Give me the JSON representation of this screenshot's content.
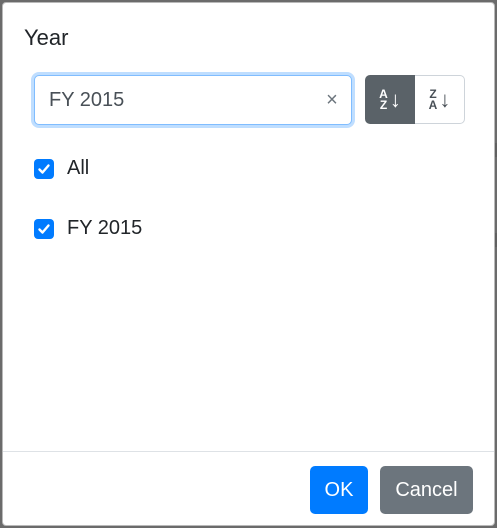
{
  "dialog": {
    "title": "Year",
    "search": {
      "value": "FY 2015",
      "clear_glyph": "×"
    },
    "sort": {
      "ascending": {
        "top": "A",
        "bottom": "Z",
        "arrow": "↓",
        "active": true
      },
      "descending": {
        "top": "Z",
        "bottom": "A",
        "arrow": "↓",
        "active": false
      }
    },
    "options": [
      {
        "label": "All",
        "checked": true
      },
      {
        "label": "FY 2015",
        "checked": true
      }
    ],
    "footer": {
      "ok_label": "OK",
      "cancel_label": "Cancel"
    }
  },
  "colors": {
    "primary": "#007bff",
    "secondary": "#6c757d",
    "sort_active": "#5a6268"
  }
}
